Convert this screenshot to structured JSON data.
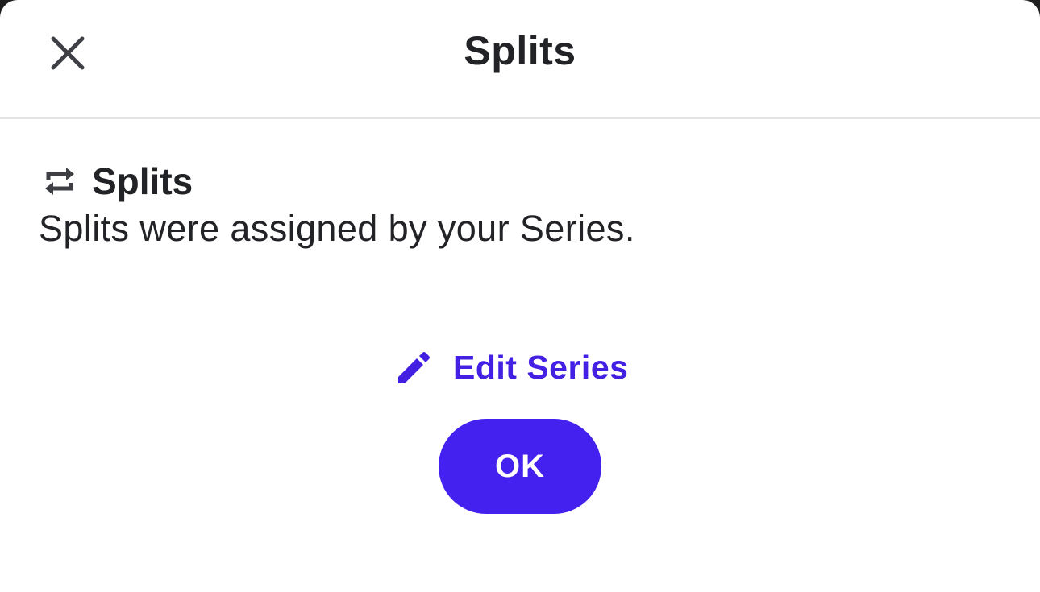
{
  "header": {
    "title": "Splits",
    "close_icon": "close-icon"
  },
  "section": {
    "icon": "swap-arrows-icon",
    "title": "Splits",
    "description": "Splits were assigned by your Series."
  },
  "actions": {
    "edit_icon": "pencil-icon",
    "edit_label": "Edit Series",
    "ok_label": "OK"
  },
  "colors": {
    "accent": "#4421ee",
    "link": "#4421e2",
    "text": "#222327",
    "divider": "#e6e6e8"
  }
}
